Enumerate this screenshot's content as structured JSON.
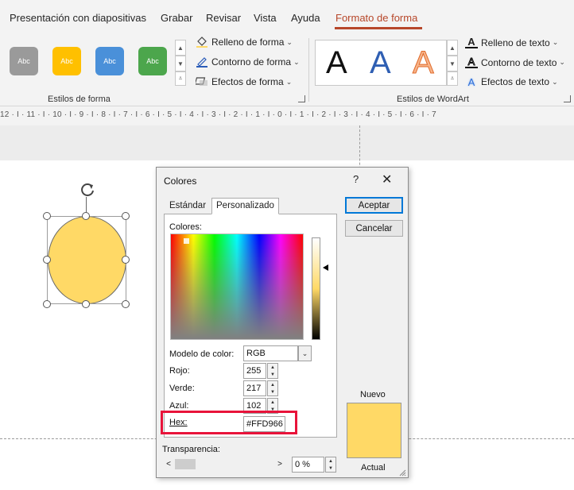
{
  "menu": {
    "tabs": [
      "Presentación con diapositivas",
      "Grabar",
      "Revisar",
      "Vista",
      "Ayuda",
      "Formato de forma"
    ],
    "active_tab": "Formato de forma"
  },
  "ribbon": {
    "shape_styles": {
      "label": "Estilos de forma",
      "swatches": [
        {
          "text": "Abc",
          "color": "#9a9a9a"
        },
        {
          "text": "Abc",
          "color": "#ffc000"
        },
        {
          "text": "Abc",
          "color": "#4a90d9"
        },
        {
          "text": "Abc",
          "color": "#4ca64c"
        }
      ],
      "fill": "Relleno de forma",
      "outline": "Contorno de forma",
      "effects": "Efectos de forma"
    },
    "wordart": {
      "label": "Estilos de WordArt",
      "letters": [
        {
          "text": "A",
          "color": "#111111"
        },
        {
          "text": "A",
          "color": "#2f5fb3"
        },
        {
          "text": "A",
          "color": "#f7b48a"
        }
      ],
      "text_fill": "Relleno de texto",
      "text_outline": "Contorno de texto",
      "text_effects": "Efectos de texto"
    }
  },
  "ruler": {
    "text": "12 · I · 11 · I · 10 · I · 9 · I · 8 · I · 7 · I · 6 · I · 5 · I · 4 · I · 3 · I · 2 · I · 1 · I · 0 · I · 1 · I · 2 · I · 3 · I · 4 · I · 5 · I · 6 · I · 7"
  },
  "shape": {
    "fill_color": "#ffd966"
  },
  "dialog": {
    "title": "Colores",
    "help": "?",
    "close": "✕",
    "tabs": {
      "standard": "Estándar",
      "custom": "Personalizado"
    },
    "colors_label": "Colores:",
    "color_model": {
      "label": "Modelo de color:",
      "value": "RGB"
    },
    "red": {
      "label": "Rojo:",
      "value": "255"
    },
    "green": {
      "label": "Verde:",
      "value": "217"
    },
    "blue": {
      "label": "Azul:",
      "value": "102"
    },
    "hex": {
      "label": "Hex:",
      "value": "#FFD966"
    },
    "transparency": {
      "label": "Transparencia:",
      "value": "0 %"
    },
    "ok": "Aceptar",
    "cancel": "Cancelar",
    "new_label": "Nuevo",
    "current_label": "Actual",
    "preview_color": "#ffd966",
    "highlight_color": "#e8133a"
  }
}
